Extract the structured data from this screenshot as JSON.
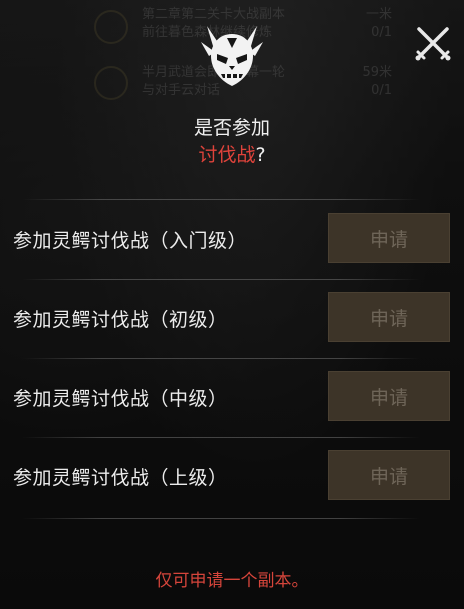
{
  "background_quests": [
    {
      "line1": "第二章第二关卡大战副本",
      "line2": "前往暮色森林继续修炼",
      "value1": "一米",
      "value2": "0/1"
    },
    {
      "line1": "半月武道会即将开幕一轮",
      "line2": "与对手云对话",
      "value1": "59米",
      "value2": "0/1"
    }
  ],
  "dialog": {
    "title_line1": "是否参加",
    "title_line2_highlight": "讨伐战",
    "title_line2_suffix": "?",
    "footer_note": "仅可申请一个副本。"
  },
  "options": [
    {
      "label": "参加灵鳄讨伐战（入门级）",
      "button": "申请"
    },
    {
      "label": "参加灵鳄讨伐战（初级）",
      "button": "申请"
    },
    {
      "label": "参加灵鳄讨伐战（中级）",
      "button": "申请"
    },
    {
      "label": "参加灵鳄讨伐战（上级）",
      "button": "申请"
    }
  ],
  "icons": {
    "close": "crossed-swords-icon",
    "header": "demon-mask-icon"
  },
  "colors": {
    "accent_red": "#e0433b",
    "button_bg": "#3d3428",
    "button_text": "#6e6558"
  }
}
